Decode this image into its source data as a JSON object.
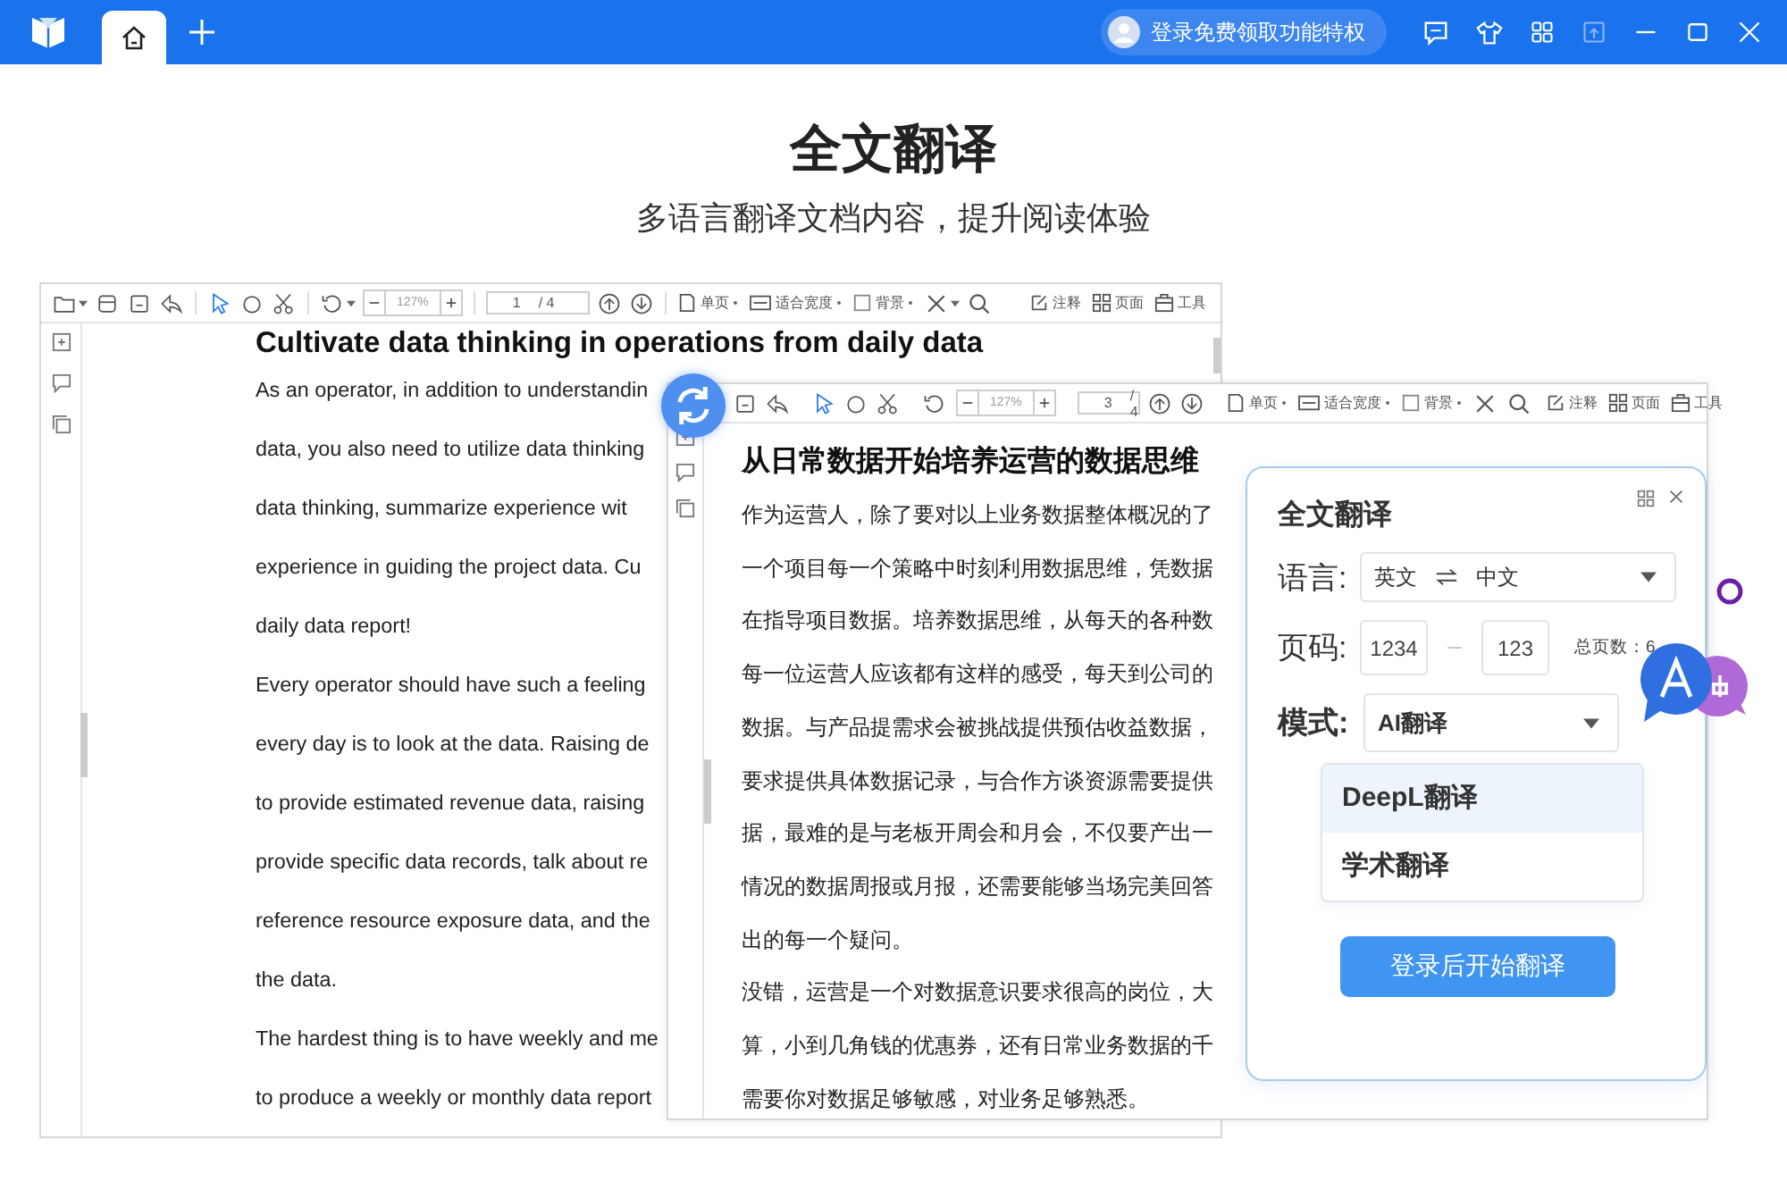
{
  "titlebar": {
    "tabs": [
      {
        "kind": "home",
        "selected": true
      }
    ],
    "login": "登录免费领取功能特权"
  },
  "hero": {
    "title": "全文翻译",
    "subtitle": "多语言翻译文档内容，提升阅读体验"
  },
  "documents": [
    {
      "toolbar": {
        "zoom": "127%",
        "page": "1",
        "total": "/ 4",
        "view_items": [
          "单页",
          "适合宽度",
          "背景"
        ],
        "right_items": [
          "注释",
          "页面",
          "工具"
        ]
      },
      "heading": "Cultivate data thinking in operations from daily data",
      "lines": [
        "As an operator, in addition to understandin",
        "data, you also need to utilize data thinking",
        "data thinking, summarize experience wit",
        "experience in guiding the project data. Cu",
        "daily data report!",
        "Every operator should have such a feeling",
        "every day is to look at the data. Raising de",
        "to provide estimated revenue data, raising",
        "provide specific data records, talk about re",
        "reference resource exposure data, and the",
        "the data.",
        "The hardest thing is to have weekly and me",
        "to produce a weekly or monthly data report"
      ]
    },
    {
      "toolbar": {
        "zoom": "127%",
        "page": "3",
        "total": "/ 4",
        "view_items": [
          "单页",
          "适合宽度",
          "背景"
        ],
        "right_items": [
          "注释",
          "页面",
          "工具"
        ]
      },
      "heading": "从日常数据开始培养运营的数据思维",
      "lines": [
        "作为运营人，除了要对以上业务数据整体概况的了",
        "一个项目每一个策略中时刻利用数据思维，凭数据",
        "在指导项目数据。培养数据思维，从每天的各种数",
        "每一位运营人应该都有这样的感受，每天到公司的",
        "数据。与产品提需求会被挑战提供预估收益数据，",
        "要求提供具体数据记录，与合作方谈资源需要提供",
        "据，最难的是与老板开周会和月会，不仅要产出一",
        "情况的数据周报或月报，还需要能够当场完美回答",
        "出的每一个疑问。",
        "没错，运营是一个对数据意识要求很高的岗位，大",
        "算，小到几角钱的优惠券，还有日常业务数据的千",
        "需要你对数据足够敏感，对业务足够熟悉。"
      ]
    }
  ],
  "translate_panel": {
    "title": "全文翻译",
    "language_label": "语言:",
    "source_language": "英文",
    "target_language": "中文",
    "pages_label": "页码:",
    "page_from": "1234",
    "page_to": "123",
    "total_pages": "总页数：6",
    "mode_label": "模式:",
    "mode": "AI翻译",
    "mode_options": [
      {
        "label": "DeepL翻译",
        "selected": true
      },
      {
        "label": "学术翻译",
        "selected": false
      }
    ],
    "start_button": "登录后开始翻译"
  }
}
